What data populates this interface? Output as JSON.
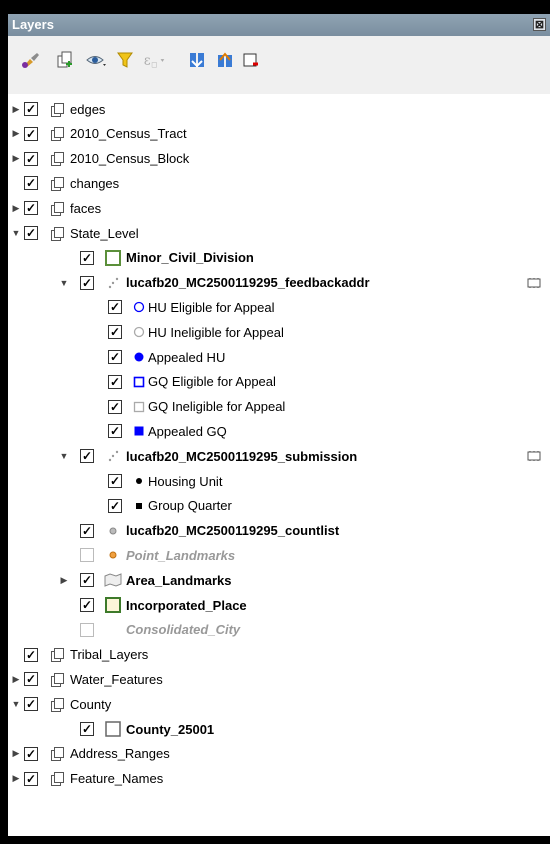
{
  "panel": {
    "title": "Layers",
    "close_label": "⊠"
  },
  "toolbar": {
    "buttons": [
      {
        "name": "style-manager",
        "icon": "paintbrush-icon"
      },
      {
        "name": "add-group",
        "icon": "add-group-icon"
      },
      {
        "name": "manage-visibility",
        "icon": "eye-icon"
      },
      {
        "name": "filter-legend",
        "icon": "filter-icon"
      },
      {
        "name": "filter-expression",
        "icon": "expression-filter-icon"
      },
      {
        "name": "expand-all",
        "icon": "expand-all-icon"
      },
      {
        "name": "collapse-all",
        "icon": "collapse-all-icon"
      },
      {
        "name": "remove-layer",
        "icon": "remove-layer-icon"
      }
    ]
  },
  "tree": {
    "rows": [
      {
        "label": "edges",
        "level": 0,
        "arrow": "closed",
        "checked": true,
        "icon": "group",
        "style": "normal"
      },
      {
        "label": "2010_Census_Tract",
        "level": 0,
        "arrow": "closed",
        "checked": true,
        "icon": "group",
        "style": "normal"
      },
      {
        "label": "2010_Census_Block",
        "level": 0,
        "arrow": "closed",
        "checked": true,
        "icon": "group",
        "style": "normal"
      },
      {
        "label": "changes",
        "level": 0,
        "arrow": "none",
        "checked": true,
        "icon": "group",
        "style": "normal"
      },
      {
        "label": "faces",
        "level": 0,
        "arrow": "closed",
        "checked": true,
        "icon": "group",
        "style": "normal"
      },
      {
        "label": "State_Level",
        "level": 0,
        "arrow": "open",
        "checked": true,
        "icon": "group",
        "style": "normal"
      },
      {
        "label": "Minor_Civil_Division",
        "level": 1,
        "arrow": "none",
        "checked": true,
        "icon": "poly-green",
        "style": "bold"
      },
      {
        "label": "lucafb20_MC2500119295_feedbackaddr",
        "level": 1,
        "arrow": "open",
        "checked": true,
        "icon": "points-dots",
        "style": "bold",
        "edit": true
      },
      {
        "label": "HU Eligible for Appeal",
        "level": 2,
        "arrow": "none",
        "checked": true,
        "icon": "circle-blue-outline",
        "style": "normal"
      },
      {
        "label": "HU Ineligible for Appeal",
        "level": 2,
        "arrow": "none",
        "checked": true,
        "icon": "circle-gray-outline",
        "style": "normal"
      },
      {
        "label": "Appealed HU",
        "level": 2,
        "arrow": "none",
        "checked": true,
        "icon": "circle-blue-fill",
        "style": "normal"
      },
      {
        "label": "GQ Eligible for Appeal",
        "level": 2,
        "arrow": "none",
        "checked": true,
        "icon": "square-blue-outline",
        "style": "normal"
      },
      {
        "label": "GQ Ineligible for Appeal",
        "level": 2,
        "arrow": "none",
        "checked": true,
        "icon": "square-gray-outline",
        "style": "normal"
      },
      {
        "label": "Appealed GQ",
        "level": 2,
        "arrow": "none",
        "checked": true,
        "icon": "square-blue-fill",
        "style": "normal"
      },
      {
        "label": "lucafb20_MC2500119295_submission",
        "level": 1,
        "arrow": "open",
        "checked": true,
        "icon": "points-dots",
        "style": "bold",
        "edit": true
      },
      {
        "label": "Housing Unit",
        "level": 2,
        "arrow": "none",
        "checked": true,
        "icon": "circle-black-fill",
        "style": "normal"
      },
      {
        "label": "Group Quarter",
        "level": 2,
        "arrow": "none",
        "checked": true,
        "icon": "square-black-fill",
        "style": "normal"
      },
      {
        "label": "lucafb20_MC2500119295_countlist",
        "level": 1,
        "arrow": "none",
        "checked": true,
        "icon": "circle-gray-small",
        "style": "bold"
      },
      {
        "label": "Point_Landmarks",
        "level": 1,
        "arrow": "none",
        "checked": false,
        "icon": "circle-orange-small",
        "style": "disabled"
      },
      {
        "label": "Area_Landmarks",
        "level": 1,
        "arrow": "closed",
        "checked": true,
        "icon": "poly-gray",
        "style": "bold"
      },
      {
        "label": "Incorporated_Place",
        "level": 1,
        "arrow": "none",
        "checked": true,
        "icon": "poly-green-yellow",
        "style": "bold"
      },
      {
        "label": "Consolidated_City",
        "level": 1,
        "arrow": "none",
        "checked": false,
        "icon": "none",
        "style": "disabled"
      },
      {
        "label": "Tribal_Layers",
        "level": 0,
        "arrow": "none",
        "checked": true,
        "icon": "group",
        "style": "normal"
      },
      {
        "label": "Water_Features",
        "level": 0,
        "arrow": "closed",
        "checked": true,
        "icon": "group",
        "style": "normal"
      },
      {
        "label": "County",
        "level": 0,
        "arrow": "open",
        "checked": true,
        "icon": "group",
        "style": "normal"
      },
      {
        "label": "County_25001",
        "level": 1,
        "arrow": "none",
        "checked": true,
        "icon": "poly-white",
        "style": "bold"
      },
      {
        "label": "Address_Ranges",
        "level": 0,
        "arrow": "closed",
        "checked": true,
        "icon": "group",
        "style": "normal"
      },
      {
        "label": "Feature_Names",
        "level": 0,
        "arrow": "closed",
        "checked": true,
        "icon": "group",
        "style": "normal"
      }
    ]
  },
  "colors": {
    "titlebar": "#7f93a4",
    "symbol_blue": "#0000ff",
    "green_border": "#5b8f3a"
  }
}
